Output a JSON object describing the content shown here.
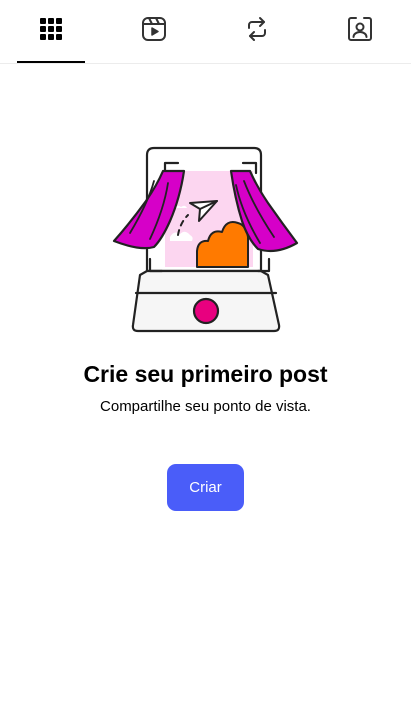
{
  "tabs": [
    {
      "icon": "grid-icon",
      "selected": true
    },
    {
      "icon": "reels-icon",
      "selected": false
    },
    {
      "icon": "reposts-icon",
      "selected": false
    },
    {
      "icon": "tagged-icon",
      "selected": false
    }
  ],
  "empty_state": {
    "title": "Crie seu primeiro post",
    "subtitle": "Compartilhe seu ponto de vista.",
    "button_label": "Criar"
  },
  "colors": {
    "accent_button": "#4a5df9",
    "curtain": "#d600c8",
    "record_button": "#e8007f",
    "cloud": "#ff7a00",
    "screen_bg": "#fcd6f0"
  }
}
